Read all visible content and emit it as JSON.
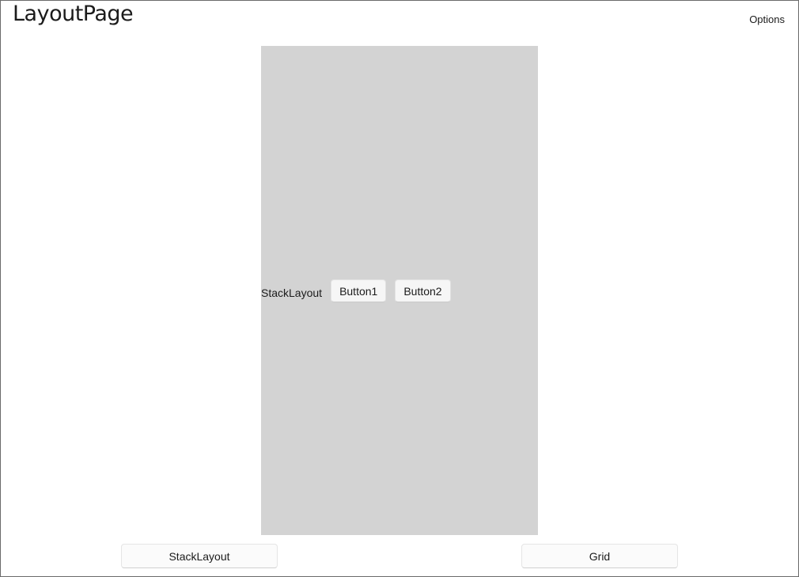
{
  "header": {
    "title": "LayoutPage",
    "options_label": "Options"
  },
  "panel": {
    "stack_label": "StackLayout",
    "button1_label": "Button1",
    "button2_label": "Button2",
    "background_color": "#d3d3d3"
  },
  "footer": {
    "stacklayout_button_label": "StackLayout",
    "grid_button_label": "Grid"
  }
}
